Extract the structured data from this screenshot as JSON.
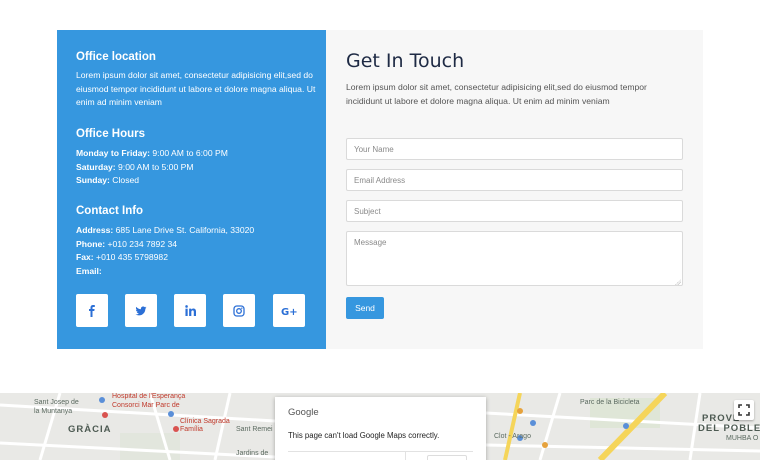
{
  "contact_info": {
    "office_location": {
      "title": "Office location",
      "text": "Lorem ipsum dolor sit amet, consectetur adipisicing elit,sed do eiusmod tempor incididunt ut labore et dolore magna aliqua. Ut enim ad minim veniam"
    },
    "office_hours": {
      "title": "Office Hours",
      "rows": [
        {
          "label": "Monday to Friday:",
          "value": " 9:00 AM to 6:00 PM"
        },
        {
          "label": "Saturday:",
          "value": " 9:00 AM to 5:00 PM"
        },
        {
          "label": "Sunday:",
          "value": " Closed"
        }
      ]
    },
    "contact": {
      "title": "Contact Info",
      "rows": [
        {
          "label": "Address:",
          "value": " 685 Lane Drive St. California, 33020"
        },
        {
          "label": "Phone:",
          "value": " +010 234 7892 34"
        },
        {
          "label": "Fax:",
          "value": " +010 435 5798982"
        },
        {
          "label": "Email:",
          "value": ""
        }
      ]
    },
    "social_icons": [
      "facebook-icon",
      "twitter-icon",
      "linkedin-icon",
      "instagram-icon",
      "google-plus-icon"
    ]
  },
  "form": {
    "title": "Get In Touch",
    "description": "Lorem ipsum dolor sit amet, consectetur adipisicing elit,sed do eiusmod tempor incididunt ut labore et dolore magna aliqua. Ut enim ad minim veniam",
    "name_placeholder": "Your Name",
    "email_placeholder": "Email Address",
    "subject_placeholder": "Subject",
    "message_placeholder": "Message",
    "send_label": "Send"
  },
  "map": {
    "labels": {
      "sant_josep": "Sant Josep de",
      "muntanya": "la Muntanya",
      "gracia": "GRÀCIA",
      "hospital": "Hospital de l'Esperança",
      "consorci": "Consorci Mar Parc de",
      "clinica": "Clínica Sagrada",
      "familia": "Família",
      "remei": "Sant Remei",
      "jardins": "Jardins de",
      "clot": "Clot - Arago",
      "bicicleta": "Parc de la Bicicleta",
      "poblenou": "PROVE",
      "del_poble": "DEL POBLE",
      "muhba": "MUHBA O"
    },
    "dialog": {
      "brand": "Google",
      "message": "This page can't load Google Maps correctly."
    }
  },
  "colors": {
    "accent": "#3697df",
    "panel_bg": "#f7f7f7",
    "title": "#1e2a44"
  }
}
